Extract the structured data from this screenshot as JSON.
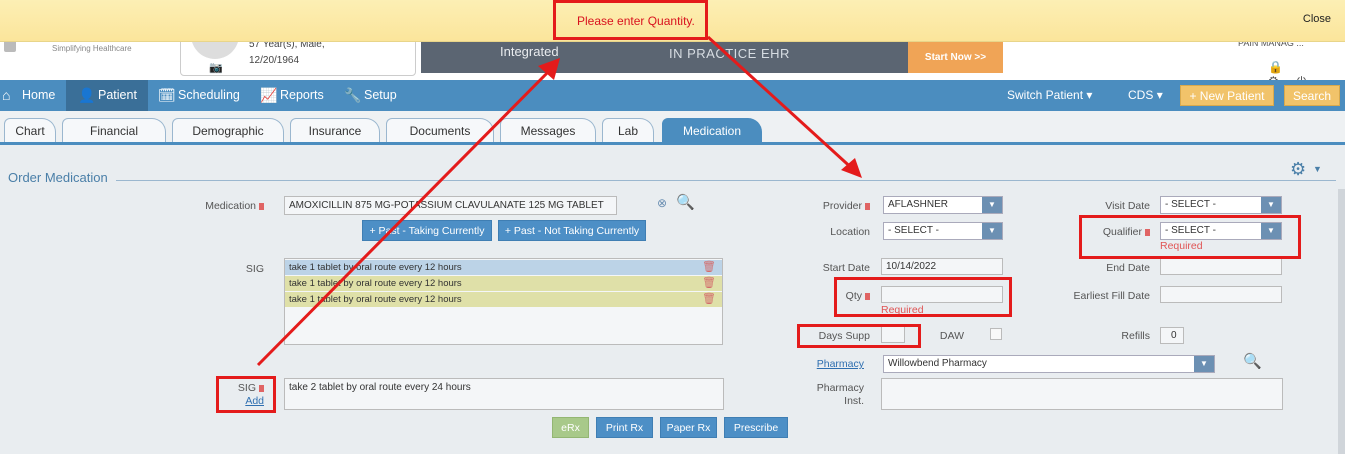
{
  "notification": {
    "message": "Please enter Quantity.",
    "close_label": "Close"
  },
  "header": {
    "logo_tagline": "Simplifying Healthcare",
    "patient_line1": "57 Year(s), Male,",
    "patient_dob": "12/20/1964",
    "banner_integrated": "Integrated",
    "banner_ehr": "IN PRACTICE EHR",
    "banner_start": "Start Now >>",
    "practice_name": "PAIN MANAG ..."
  },
  "nav": {
    "items": [
      {
        "label": "Home",
        "icon": "home-icon"
      },
      {
        "label": "Patient",
        "icon": "user-icon"
      },
      {
        "label": "Scheduling",
        "icon": "calendar-icon"
      },
      {
        "label": "Reports",
        "icon": "report-icon"
      },
      {
        "label": "Setup",
        "icon": "wrench-icon"
      }
    ],
    "switch_patient": "Switch Patient",
    "cds": "CDS",
    "new_patient": "+ New Patient",
    "search": "Search"
  },
  "tabs": [
    "Chart",
    "Financial",
    "Demographic",
    "Insurance",
    "Documents",
    "Messages",
    "Lab",
    "Medication"
  ],
  "form": {
    "section_title": "Order Medication",
    "medication_label": "Medication",
    "medication_value": "AMOXICILLIN 875 MG-POTASSIUM CLAVULANATE 125 MG TABLET",
    "past_taking_btn": "+ Past - Taking Currently",
    "past_not_taking_btn": "+ Past - Not Taking Currently",
    "sig_label": "SIG",
    "sig_list": [
      "take 1 tablet by oral route every 12 hours",
      "take 1 tablet by oral route every 12 hours",
      "take 1 tablet by oral route every 12 hours"
    ],
    "sig2_label": "SIG",
    "sig_add_link": "Add",
    "sig2_value": "take 2 tablet by oral route every 24 hours",
    "erx_btn": "eRx",
    "print_rx_btn": "Print Rx",
    "paper_rx_btn": "Paper Rx",
    "prescribe_btn": "Prescribe",
    "provider_label": "Provider",
    "provider_value": "AFLASHNER",
    "location_label": "Location",
    "location_value": "- SELECT -",
    "start_date_label": "Start Date",
    "start_date_value": "10/14/2022",
    "qty_label": "Qty",
    "qty_required": "Required",
    "days_supp_label": "Days Supp",
    "daw_label": "DAW",
    "pharmacy_label": "Pharmacy",
    "pharmacy_value": "Willowbend Pharmacy",
    "pharmacy_inst_label1": "Pharmacy",
    "pharmacy_inst_label2": "Inst.",
    "visit_date_label": "Visit Date",
    "visit_date_value": "- SELECT -",
    "qualifier_label": "Qualifier",
    "qualifier_value": "- SELECT -",
    "qualifier_required": "Required",
    "end_date_label": "End Date",
    "earliest_fill_label": "Earliest Fill Date",
    "refills_label": "Refills",
    "refills_value": "0"
  }
}
